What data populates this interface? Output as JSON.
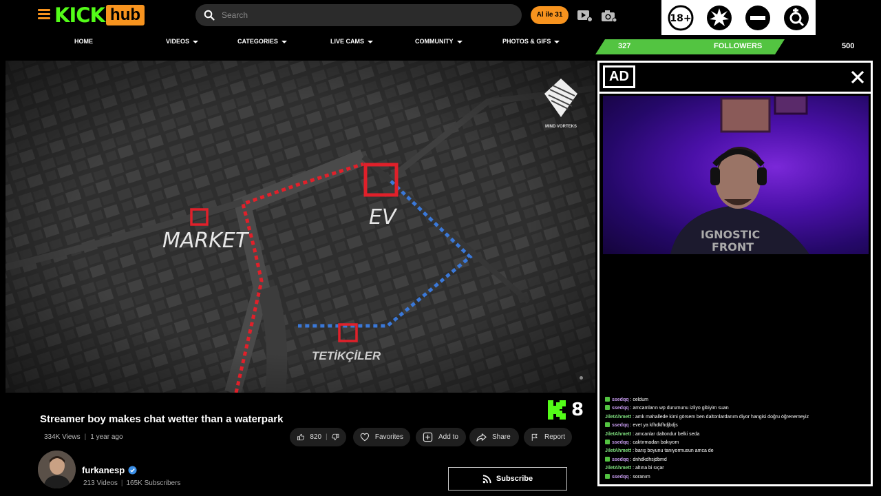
{
  "header": {
    "logo_kick": "KICK",
    "logo_hub": "hub",
    "search_placeholder": "Search",
    "promo_pill": "Al ile 31"
  },
  "nav": [
    {
      "label": "HOME",
      "dropdown": false
    },
    {
      "label": "VIDEOS",
      "dropdown": true
    },
    {
      "label": "CATEGORIES",
      "dropdown": true
    },
    {
      "label": "LIVE CAMS",
      "dropdown": true
    },
    {
      "label": "COMMUNITY",
      "dropdown": true
    },
    {
      "label": "PHOTOS & GIFS",
      "dropdown": true
    }
  ],
  "badges": [
    "18-plus-icon",
    "explosion-icon",
    "no-entry-icon",
    "gender-search-icon"
  ],
  "followers": {
    "current": "327",
    "label": "FOLLOWERS",
    "goal": "500",
    "progress": 0.654
  },
  "video": {
    "watermark": "MIND VORTEKS",
    "labels": {
      "market": "MARKET",
      "ev": "EV",
      "tetikciler": "TETİKÇİLER"
    },
    "title": "Streamer boy makes chat wetter than a waterpark",
    "views": "334K Views",
    "age": "1 year ago",
    "kick_counter": "8"
  },
  "actions": {
    "likes": "820",
    "favorites": "Favorites",
    "add_to": "Add to",
    "share": "Share",
    "report": "Report"
  },
  "channel": {
    "name": "furkanesp",
    "videos": "213 Videos",
    "subscribers": "165K Subscribers",
    "subscribe_label": "Subscribe"
  },
  "ad": {
    "label": "AD",
    "shirt_text_1": "IGNOSTIC",
    "shirt_text_2": "FRONT",
    "chat": [
      {
        "user": "ssedqq",
        "text": "celdum",
        "color": "#c89cf0",
        "icon": true
      },
      {
        "user": "ssedqq",
        "text": "amcamların wp durumunu izliyo gibiyim suan",
        "color": "#c89cf0",
        "icon": true
      },
      {
        "user": "JiletAhmett",
        "text": "amk mahallede kimi görsem ben daltonlardanım diyor hangisi doğru öğrenemeyiz",
        "color": "#7fe07f",
        "icon": false
      },
      {
        "user": "ssedqq",
        "text": "evet ya kfhdkfhdjbdjs",
        "color": "#c89cf0",
        "icon": true
      },
      {
        "user": "JiletAhmett",
        "text": "amcanlar daltondur belki seda",
        "color": "#7fe07f",
        "icon": false
      },
      {
        "user": "ssedqq",
        "text": "caktırmadan bakıyom",
        "color": "#c89cf0",
        "icon": true
      },
      {
        "user": "JiletAhmett",
        "text": "barış boyunu tanıyormusun amca de",
        "color": "#7fe07f",
        "icon": false
      },
      {
        "user": "ssedqq",
        "text": "dnhdkdhsjdbmd",
        "color": "#c89cf0",
        "icon": true
      },
      {
        "user": "JiletAhmett",
        "text": "altına bi sıçar",
        "color": "#7fe07f",
        "icon": false
      },
      {
        "user": "ssedqq",
        "text": "soranım",
        "color": "#c89cf0",
        "icon": true
      }
    ]
  },
  "colors": {
    "accent_orange": "#f7931e",
    "kick_green": "#53fc18",
    "followers_green": "#53c441",
    "route_red": "#e0202a",
    "route_blue": "#3a78d8"
  }
}
